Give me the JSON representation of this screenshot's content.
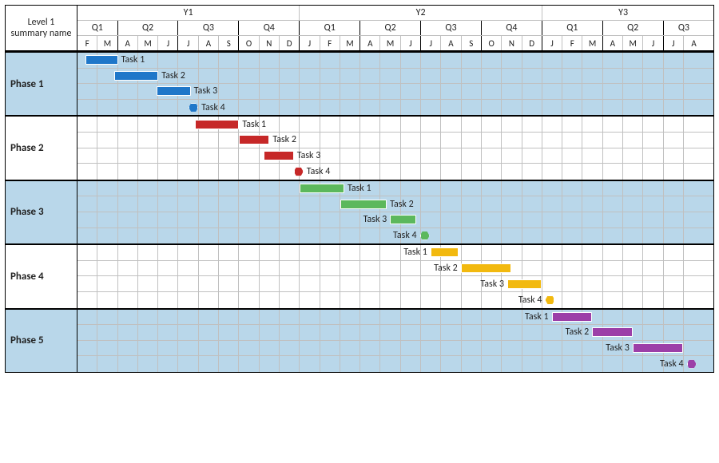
{
  "corner_label": "Level 1 summary name",
  "months_sequence": [
    "F",
    "M",
    "A",
    "M",
    "J",
    "J",
    "A",
    "S",
    "O",
    "N",
    "D",
    "J",
    "F",
    "M",
    "A",
    "M",
    "J",
    "J",
    "A",
    "S",
    "O",
    "N",
    "D",
    "J",
    "F",
    "M",
    "A",
    "M",
    "J",
    "J",
    "A"
  ],
  "years": [
    {
      "label": "Y1",
      "span": 11
    },
    {
      "label": "Y2",
      "span": 12
    },
    {
      "label": "Y3",
      "span": 8
    }
  ],
  "quarters": [
    {
      "label": "Q1",
      "span": 2
    },
    {
      "label": "Q2",
      "span": 3
    },
    {
      "label": "Q3",
      "span": 3
    },
    {
      "label": "Q4",
      "span": 3
    },
    {
      "label": "Q1",
      "span": 3
    },
    {
      "label": "Q2",
      "span": 3
    },
    {
      "label": "Q3",
      "span": 3
    },
    {
      "label": "Q4",
      "span": 3
    },
    {
      "label": "Q1",
      "span": 3
    },
    {
      "label": "Q2",
      "span": 3
    },
    {
      "label": "Q3",
      "span": 2
    }
  ],
  "phases": [
    {
      "name": "Phase 1",
      "shaded": true,
      "color": "#1f77c9",
      "label_side": "right",
      "tasks": [
        {
          "label": "Task 1",
          "start": 0.4,
          "duration": 1.6,
          "type": "bar"
        },
        {
          "label": "Task 2",
          "start": 1.8,
          "duration": 2.2,
          "type": "bar"
        },
        {
          "label": "Task 3",
          "start": 3.9,
          "duration": 1.7,
          "type": "bar"
        },
        {
          "label": "Task 4",
          "start": 5.5,
          "duration": 0,
          "type": "milestone"
        }
      ]
    },
    {
      "name": "Phase 2",
      "shaded": false,
      "color": "#c62828",
      "label_side": "right",
      "tasks": [
        {
          "label": "Task 1",
          "start": 5.8,
          "duration": 2.2,
          "type": "bar"
        },
        {
          "label": "Task 2",
          "start": 8.0,
          "duration": 1.5,
          "type": "bar"
        },
        {
          "label": "Task 3",
          "start": 9.2,
          "duration": 1.5,
          "type": "bar"
        },
        {
          "label": "Task 4",
          "start": 10.7,
          "duration": 0,
          "type": "milestone"
        }
      ]
    },
    {
      "name": "Phase 3",
      "shaded": true,
      "color": "#5cb85c",
      "label_side": "right",
      "tasks": [
        {
          "label": "Task 1",
          "start": 11.0,
          "duration": 2.2,
          "type": "bar"
        },
        {
          "label": "Task 2",
          "start": 13.0,
          "duration": 2.3,
          "type": "bar"
        },
        {
          "label": "Task 3",
          "start": 15.0,
          "duration": 1.3,
          "type": "bar",
          "label_side": "left"
        },
        {
          "label": "Task 4",
          "start": 16.4,
          "duration": 0,
          "type": "milestone",
          "label_side": "left"
        }
      ]
    },
    {
      "name": "Phase 4",
      "shaded": false,
      "color": "#f2b90f",
      "label_side": "left",
      "tasks": [
        {
          "label": "Task 1",
          "start": 17.0,
          "duration": 1.4,
          "type": "bar"
        },
        {
          "label": "Task 2",
          "start": 18.5,
          "duration": 2.5,
          "type": "bar"
        },
        {
          "label": "Task 3",
          "start": 20.8,
          "duration": 1.7,
          "type": "bar"
        },
        {
          "label": "Task 4",
          "start": 22.6,
          "duration": 0,
          "type": "milestone"
        }
      ]
    },
    {
      "name": "Phase 5",
      "shaded": true,
      "color": "#9c3fa8",
      "label_side": "left",
      "tasks": [
        {
          "label": "Task 1",
          "start": 23.0,
          "duration": 2.0,
          "type": "bar"
        },
        {
          "label": "Task 2",
          "start": 25.0,
          "duration": 2.0,
          "type": "bar"
        },
        {
          "label": "Task 3",
          "start": 27.0,
          "duration": 2.5,
          "type": "bar"
        },
        {
          "label": "Task 4",
          "start": 29.6,
          "duration": 0,
          "type": "milestone"
        }
      ]
    }
  ],
  "chart_data": {
    "type": "gantt",
    "title": "",
    "time_axis": {
      "start_month": "Feb Y1",
      "end_month": "Aug Y3",
      "total_months": 31
    },
    "categories": [
      "Phase 1",
      "Phase 2",
      "Phase 3",
      "Phase 4",
      "Phase 5"
    ],
    "series": [
      {
        "phase": "Phase 1",
        "task": "Task 1",
        "start_month_index": 0.4,
        "duration_months": 1.6,
        "milestone": false,
        "color": "#1f77c9"
      },
      {
        "phase": "Phase 1",
        "task": "Task 2",
        "start_month_index": 1.8,
        "duration_months": 2.2,
        "milestone": false,
        "color": "#1f77c9"
      },
      {
        "phase": "Phase 1",
        "task": "Task 3",
        "start_month_index": 3.9,
        "duration_months": 1.7,
        "milestone": false,
        "color": "#1f77c9"
      },
      {
        "phase": "Phase 1",
        "task": "Task 4",
        "start_month_index": 5.5,
        "duration_months": 0,
        "milestone": true,
        "color": "#1f77c9"
      },
      {
        "phase": "Phase 2",
        "task": "Task 1",
        "start_month_index": 5.8,
        "duration_months": 2.2,
        "milestone": false,
        "color": "#c62828"
      },
      {
        "phase": "Phase 2",
        "task": "Task 2",
        "start_month_index": 8.0,
        "duration_months": 1.5,
        "milestone": false,
        "color": "#c62828"
      },
      {
        "phase": "Phase 2",
        "task": "Task 3",
        "start_month_index": 9.2,
        "duration_months": 1.5,
        "milestone": false,
        "color": "#c62828"
      },
      {
        "phase": "Phase 2",
        "task": "Task 4",
        "start_month_index": 10.7,
        "duration_months": 0,
        "milestone": true,
        "color": "#c62828"
      },
      {
        "phase": "Phase 3",
        "task": "Task 1",
        "start_month_index": 11.0,
        "duration_months": 2.2,
        "milestone": false,
        "color": "#5cb85c"
      },
      {
        "phase": "Phase 3",
        "task": "Task 2",
        "start_month_index": 13.0,
        "duration_months": 2.3,
        "milestone": false,
        "color": "#5cb85c"
      },
      {
        "phase": "Phase 3",
        "task": "Task 3",
        "start_month_index": 15.0,
        "duration_months": 1.3,
        "milestone": false,
        "color": "#5cb85c"
      },
      {
        "phase": "Phase 3",
        "task": "Task 4",
        "start_month_index": 16.4,
        "duration_months": 0,
        "milestone": true,
        "color": "#5cb85c"
      },
      {
        "phase": "Phase 4",
        "task": "Task 1",
        "start_month_index": 17.0,
        "duration_months": 1.4,
        "milestone": false,
        "color": "#f2b90f"
      },
      {
        "phase": "Phase 4",
        "task": "Task 2",
        "start_month_index": 18.5,
        "duration_months": 2.5,
        "milestone": false,
        "color": "#f2b90f"
      },
      {
        "phase": "Phase 4",
        "task": "Task 3",
        "start_month_index": 20.8,
        "duration_months": 1.7,
        "milestone": false,
        "color": "#f2b90f"
      },
      {
        "phase": "Phase 4",
        "task": "Task 4",
        "start_month_index": 22.6,
        "duration_months": 0,
        "milestone": true,
        "color": "#f2b90f"
      },
      {
        "phase": "Phase 5",
        "task": "Task 1",
        "start_month_index": 23.0,
        "duration_months": 2.0,
        "milestone": false,
        "color": "#9c3fa8"
      },
      {
        "phase": "Phase 5",
        "task": "Task 2",
        "start_month_index": 25.0,
        "duration_months": 2.0,
        "milestone": false,
        "color": "#9c3fa8"
      },
      {
        "phase": "Phase 5",
        "task": "Task 3",
        "start_month_index": 27.0,
        "duration_months": 2.5,
        "milestone": false,
        "color": "#9c3fa8"
      },
      {
        "phase": "Phase 5",
        "task": "Task 4",
        "start_month_index": 29.6,
        "duration_months": 0,
        "milestone": true,
        "color": "#9c3fa8"
      }
    ]
  }
}
